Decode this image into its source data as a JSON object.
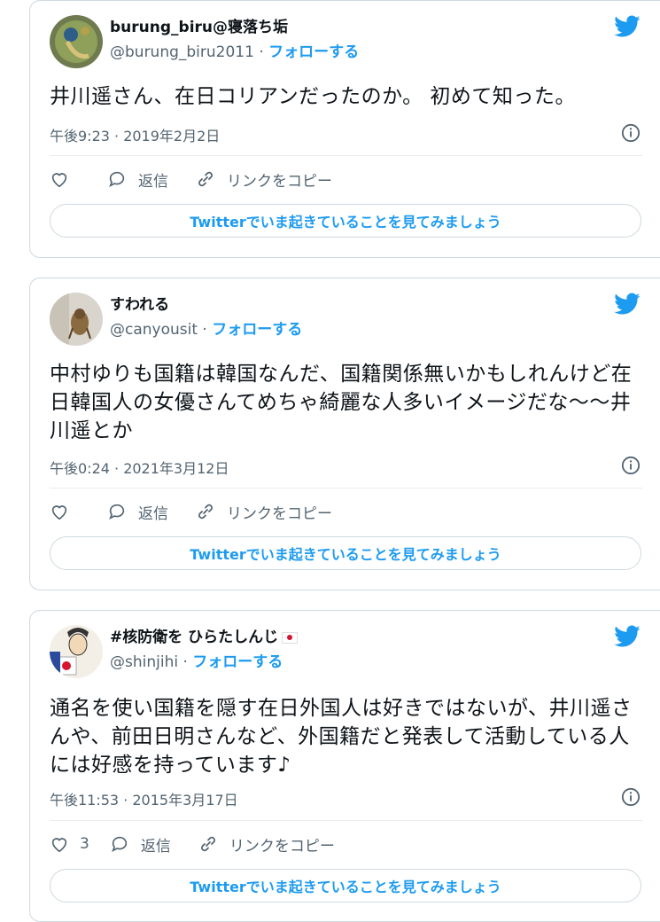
{
  "tweets": [
    {
      "display_name": "burung_biru@寝落ち垢",
      "handle": "@burung_biru2011",
      "separator": " · ",
      "follow_label": "フォローする",
      "text": "井川遥さん、在日コリアンだったのか。 初めて知った。",
      "timestamp": "午後9:23 · 2019年2月2日",
      "like_count": "",
      "reply_label": "返信",
      "copy_link_label": "リンクをコピー",
      "cta_label": "Twitterでいま起きていることを見てみましょう"
    },
    {
      "display_name": "すわれる",
      "handle": "@canyousit",
      "separator": " · ",
      "follow_label": "フォローする",
      "text": "中村ゆりも国籍は韓国なんだ、国籍関係無いかもしれんけど在日韓国人の女優さんてめちゃ綺麗な人多いイメージだな〜〜井川遥とか",
      "timestamp": "午後0:24 · 2021年3月12日",
      "like_count": "",
      "reply_label": "返信",
      "copy_link_label": "リンクをコピー",
      "cta_label": "Twitterでいま起きていることを見てみましょう"
    },
    {
      "display_name": "#核防衛を ひらたしんじ",
      "handle": "@shinjihi",
      "separator": " · ",
      "follow_label": "フォローする",
      "text": "通名を使い国籍を隠す在日外国人は好きではないが、井川遥さんや、前田日明さんなど、外国籍だと発表して活動している人には好感を持っています♪",
      "timestamp": "午後11:53 · 2015年3月17日",
      "like_count": "3",
      "reply_label": "返信",
      "copy_link_label": "リンクをコピー",
      "cta_label": "Twitterでいま起きていることを見てみましょう"
    }
  ],
  "colors": {
    "twitter_blue": "#1d9bf0",
    "secondary_text": "#536471",
    "border": "#cfd9de"
  },
  "icons": [
    "twitter-bird-icon",
    "info-icon",
    "heart-icon",
    "reply-icon",
    "link-icon",
    "japan-flag-icon"
  ]
}
